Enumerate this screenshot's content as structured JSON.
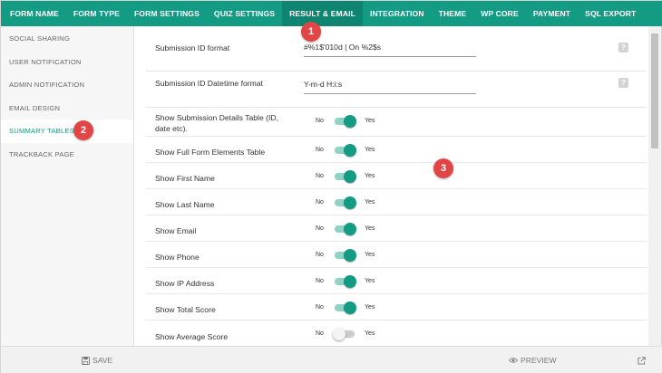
{
  "nav": {
    "tabs": [
      {
        "label": "FORM NAME"
      },
      {
        "label": "FORM TYPE"
      },
      {
        "label": "FORM SETTINGS"
      },
      {
        "label": "QUIZ SETTINGS"
      },
      {
        "label": "RESULT & EMAIL"
      },
      {
        "label": "INTEGRATION"
      },
      {
        "label": "THEME"
      },
      {
        "label": "WP CORE"
      },
      {
        "label": "PAYMENT"
      },
      {
        "label": "SQL EXPORT"
      }
    ],
    "active": "RESULT & EMAIL"
  },
  "sidebar": {
    "items": [
      {
        "label": "SOCIAL SHARING"
      },
      {
        "label": "USER NOTIFICATION"
      },
      {
        "label": "ADMIN NOTIFICATION"
      },
      {
        "label": "EMAIL DESIGN"
      },
      {
        "label": "SUMMARY TABLES"
      },
      {
        "label": "TRACKBACK PAGE"
      }
    ],
    "active": "SUMMARY TABLES"
  },
  "settings": {
    "submission_id_format": {
      "label": "Submission ID format",
      "value": "#%1$'010d | On %2$s"
    },
    "submission_datetime_format": {
      "label": "Submission ID Datetime format",
      "value": "Y-m-d H:i:s"
    },
    "toggles": [
      {
        "label": "Show Submission Details Table (ID, date etc).",
        "no": "No",
        "yes": "Yes",
        "on": true
      },
      {
        "label": "Show Full Form Elements Table",
        "no": "No",
        "yes": "Yes",
        "on": true
      },
      {
        "label": "Show First Name",
        "no": "No",
        "yes": "Yes",
        "on": true
      },
      {
        "label": "Show Last Name",
        "no": "No",
        "yes": "Yes",
        "on": true
      },
      {
        "label": "Show Email",
        "no": "No",
        "yes": "Yes",
        "on": true
      },
      {
        "label": "Show Phone",
        "no": "No",
        "yes": "Yes",
        "on": true
      },
      {
        "label": "Show IP Address",
        "no": "No",
        "yes": "Yes",
        "on": true
      },
      {
        "label": "Show Total Score",
        "no": "No",
        "yes": "Yes",
        "on": true
      },
      {
        "label": "Show Average Score",
        "no": "No",
        "yes": "Yes",
        "on": false
      }
    ]
  },
  "footer": {
    "save_label": "SAVE",
    "preview_label": "PREVIEW"
  },
  "annotations": [
    "1",
    "2",
    "3"
  ],
  "colors": {
    "accent": "#139b84",
    "badge": "#e24546"
  }
}
